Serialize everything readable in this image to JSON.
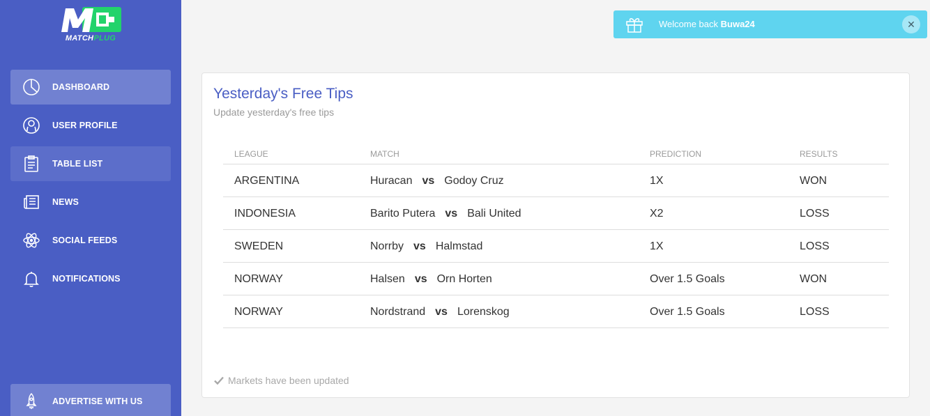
{
  "logo": {
    "mark": "M",
    "name_part1": "MATCH",
    "name_part2": "PLUG"
  },
  "sidebar": {
    "items": [
      {
        "label": "DASHBOARD",
        "icon": "pie-chart-icon"
      },
      {
        "label": "USER PROFILE",
        "icon": "user-icon"
      },
      {
        "label": "TABLE LIST",
        "icon": "clipboard-icon"
      },
      {
        "label": "NEWS",
        "icon": "newspaper-icon"
      },
      {
        "label": "SOCIAL FEEDS",
        "icon": "atom-icon"
      },
      {
        "label": "NOTIFICATIONS",
        "icon": "bell-icon"
      }
    ],
    "advertise": {
      "label": "ADVERTISE WITH US",
      "icon": "rocket-icon"
    }
  },
  "toast": {
    "prefix": "Welcome back",
    "username": "Buwa24",
    "close": "✕"
  },
  "card": {
    "title": "Yesterday's Free Tips",
    "subtitle": "Update yesterday's free tips",
    "footer": "Markets have been updated"
  },
  "table": {
    "headers": {
      "league": "LEAGUE",
      "match": "MATCH",
      "prediction": "PREDICTION",
      "results": "RESULTS"
    },
    "vs": "vs",
    "rows": [
      {
        "league": "ARGENTINA",
        "home": "Huracan",
        "away": "Godoy Cruz",
        "prediction": "1X",
        "result": "WON"
      },
      {
        "league": "INDONESIA",
        "home": "Barito Putera",
        "away": "Bali United",
        "prediction": "X2",
        "result": "LOSS"
      },
      {
        "league": "SWEDEN",
        "home": "Norrby",
        "away": "Halmstad",
        "prediction": "1X",
        "result": "LOSS"
      },
      {
        "league": "NORWAY",
        "home": "Halsen",
        "away": "Orn Horten",
        "prediction": "Over 1.5 Goals",
        "result": "WON"
      },
      {
        "league": "NORWAY",
        "home": "Nordstrand",
        "away": "Lorenskog",
        "prediction": "Over 1.5 Goals",
        "result": "LOSS"
      }
    ]
  },
  "colors": {
    "sidebar": "#4a5ec4",
    "accent": "#4a5ec4",
    "logo_green": "#22d36b",
    "toast": "#5fd4ef"
  }
}
